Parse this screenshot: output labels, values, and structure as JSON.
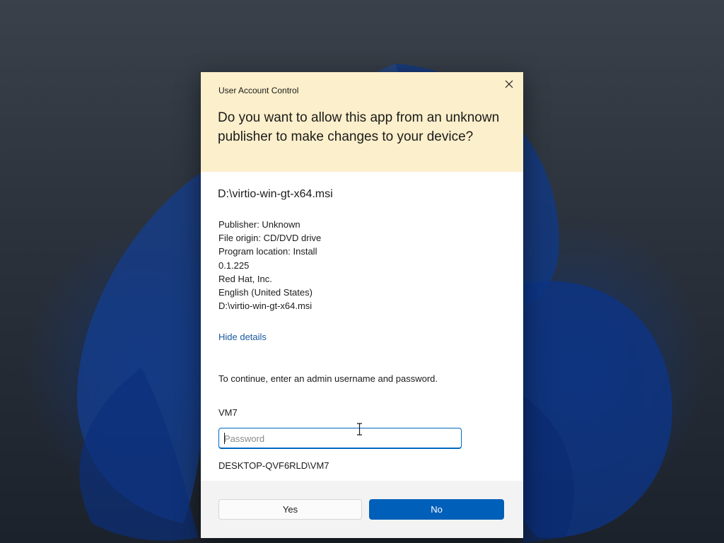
{
  "dialog": {
    "title": "User Account Control",
    "headline": "Do you want to allow this app from an unknown publisher to make changes to your device?",
    "app_path": "D:\\virtio-win-gt-x64.msi",
    "details": [
      "Publisher: Unknown",
      "File origin: CD/DVD drive",
      "Program location: Install",
      "0.1.225",
      "Red Hat, Inc.",
      "English (United States)",
      "D:\\virtio-win-gt-x64.msi"
    ],
    "hide_details_label": "Hide details",
    "instruction": "To continue, enter an admin username and password.",
    "username": "VM7",
    "password_placeholder": "Password",
    "password_value": "",
    "domain_user": "DESKTOP-QVF6RLD\\VM7",
    "buttons": {
      "yes_label": "Yes",
      "no_label": "No"
    },
    "close_icon": "close-icon"
  },
  "colors": {
    "header_background": "#fcefcb",
    "link": "#1a5aa0",
    "accent": "#005fb8",
    "footer_background": "#f3f3f3"
  }
}
